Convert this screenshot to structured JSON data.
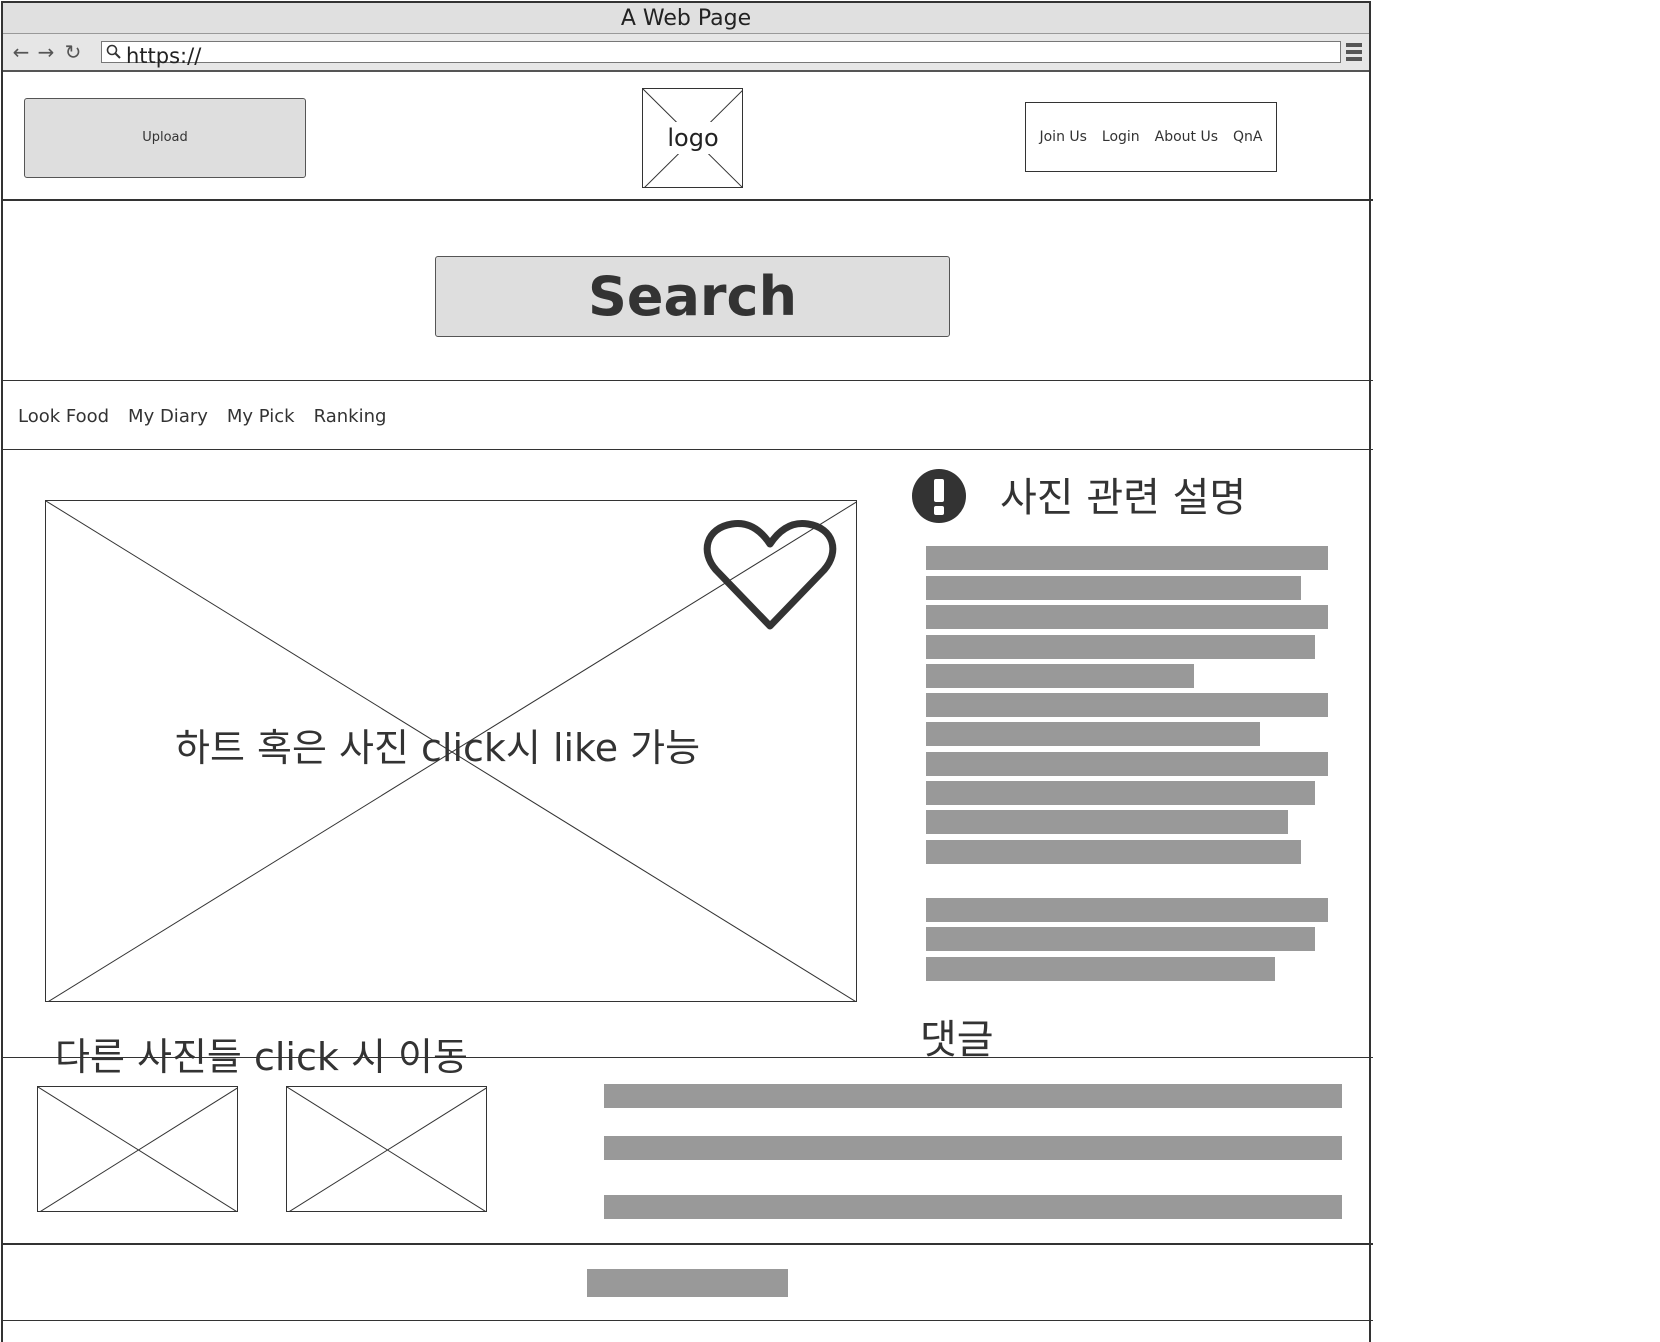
{
  "window": {
    "title": "A Web Page"
  },
  "browser": {
    "url": "https://",
    "icons": [
      "back-arrow-icon",
      "forward-arrow-icon",
      "reload-icon",
      "search-icon",
      "hamburger-menu-icon"
    ]
  },
  "header": {
    "upload_label": "Upload",
    "logo_label": "logo",
    "links": [
      "Join Us",
      "Login",
      "About Us",
      "QnA"
    ]
  },
  "search": {
    "label": "Search"
  },
  "menu": {
    "items": [
      "Look Food",
      "My Diary",
      "My Pick",
      "Ranking"
    ]
  },
  "main": {
    "photo_caption": "하트 혹은 사진 click시 like 가능",
    "description_title": "사진 관련 설명",
    "comment_title": "댓글",
    "other_photos_caption": "다른 사진들 click 시 이동"
  },
  "colors": {
    "frame": "#333333",
    "panel_gray": "#dedede",
    "text_placeholder": "#999999",
    "titlebar": "#e0e0e0"
  }
}
